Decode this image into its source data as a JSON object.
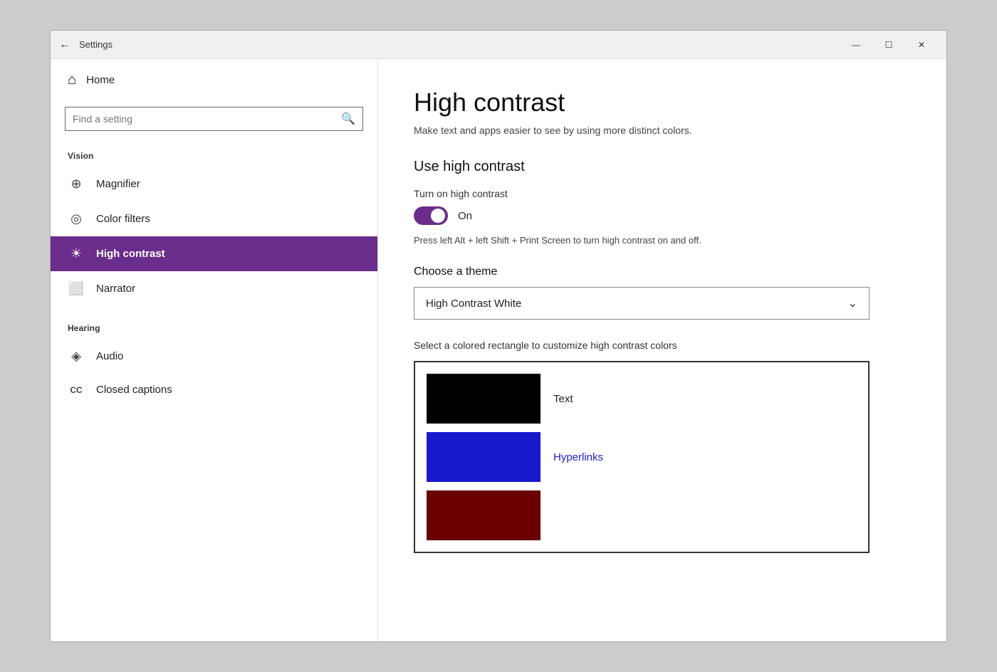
{
  "window": {
    "title": "Settings",
    "back_icon": "←",
    "min_btn": "—",
    "max_btn": "☐",
    "close_btn": "✕"
  },
  "sidebar": {
    "home_label": "Home",
    "home_icon": "⌂",
    "search_placeholder": "Find a setting",
    "search_icon": "🔍",
    "section_vision": "Vision",
    "nav_items": [
      {
        "id": "magnifier",
        "icon": "⊕",
        "label": "Magnifier",
        "active": false
      },
      {
        "id": "color-filters",
        "icon": "◎",
        "label": "Color filters",
        "active": false
      },
      {
        "id": "high-contrast",
        "icon": "☀",
        "label": "High contrast",
        "active": true
      },
      {
        "id": "narrator",
        "icon": "⬜",
        "label": "Narrator",
        "active": false
      }
    ],
    "section_hearing": "Hearing",
    "hearing_items": [
      {
        "id": "audio",
        "icon": "◈",
        "label": "Audio",
        "active": false
      },
      {
        "id": "closed-captions",
        "icon": "CC",
        "label": "Closed captions",
        "active": false
      }
    ]
  },
  "main": {
    "page_title": "High contrast",
    "page_subtitle": "Make text and apps easier to see by using more distinct colors.",
    "use_section_heading": "Use high contrast",
    "toggle_label": "Turn on high contrast",
    "toggle_status": "On",
    "toggle_on": true,
    "hint_text": "Press left Alt + left Shift + Print Screen to turn high contrast on and off.",
    "theme_label": "Choose a theme",
    "theme_selected": "High Contrast White",
    "dropdown_arrow": "⌄",
    "customize_label": "Select a colored rectangle to customize high contrast colors",
    "color_rows": [
      {
        "id": "text",
        "color": "#000000",
        "label": "Text",
        "is_link": false
      },
      {
        "id": "hyperlinks",
        "color": "#1818CC",
        "label": "Hyperlinks",
        "is_link": true
      },
      {
        "id": "disabled-text",
        "color": "#6B0000",
        "label": "",
        "is_link": false
      }
    ]
  }
}
